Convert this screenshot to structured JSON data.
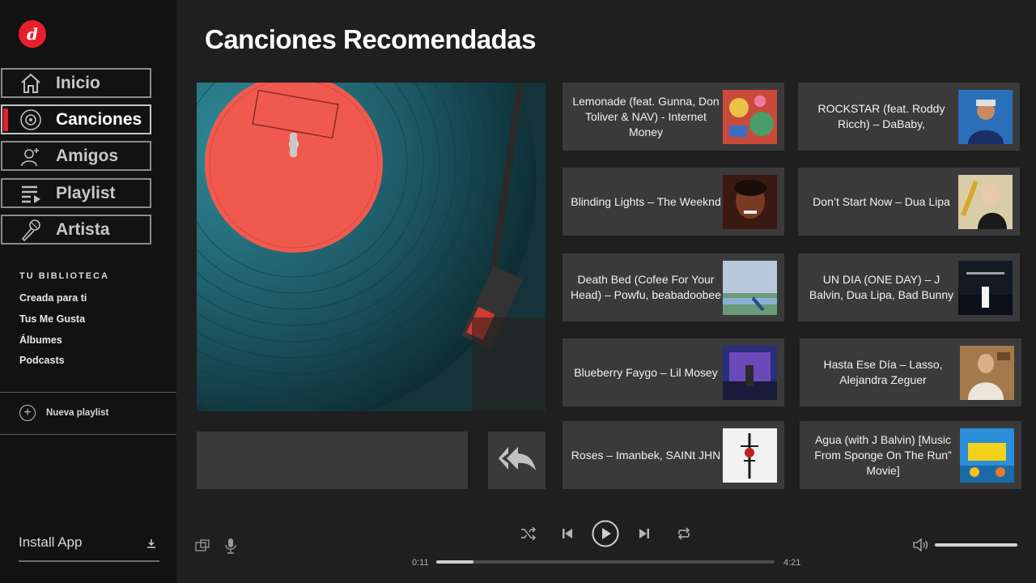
{
  "brand": {
    "logo_letter": "d"
  },
  "nav": [
    {
      "id": "inicio",
      "label": "Inicio",
      "icon": "home-icon",
      "active": false
    },
    {
      "id": "canciones",
      "label": "Canciones",
      "icon": "disc-icon",
      "active": true
    },
    {
      "id": "amigos",
      "label": "Amigos",
      "icon": "add-friend-icon",
      "active": false
    },
    {
      "id": "playlist",
      "label": "Playlist",
      "icon": "playlist-icon",
      "active": false
    },
    {
      "id": "artista",
      "label": "Artista",
      "icon": "microphone-icon",
      "active": false
    }
  ],
  "library": {
    "title": "TU BIBLIOTECA",
    "items": [
      "Creada para ti",
      "Tus Me Gusta",
      "Álbumes",
      "Podcasts"
    ]
  },
  "new_playlist": {
    "label": "Nueva playlist"
  },
  "install": {
    "label": "Install App"
  },
  "page": {
    "title": "Canciones Recomendadas"
  },
  "songs": [
    {
      "title": "Lemonade (feat. Gunna, Don Toliver & NAV) - Internet Money",
      "cover_color": "#c94a3a"
    },
    {
      "title": "ROCKSTAR (feat. Roddy Ricch) – DaBaby,",
      "cover_color": "#2a6fb8"
    },
    {
      "title": "Blinding Lights – The Weeknd",
      "cover_color": "#6b2a1a"
    },
    {
      "title": "Don’t Start Now – Dua Lipa",
      "cover_color": "#c9b68a"
    },
    {
      "title": "Death Bed (Cofee For Your Head) – Powfu, beabadoobee",
      "cover_color": "#8fa4c4"
    },
    {
      "title": "UN DIA (ONE DAY) – J Balvin, Dua Lipa, Bad Bunny",
      "cover_color": "#1a2330"
    },
    {
      "title": "Blueberry Faygo – Lil Mosey",
      "cover_color": "#3a3f8a"
    },
    {
      "title": "Hasta Ese Día – Lasso, Alejandra Zeguer",
      "cover_color": "#a47a4c"
    },
    {
      "title": "Roses – Imanbek, SAINt JHN",
      "cover_color": "#f0f0f0"
    },
    {
      "title": "Agua (with J Balvin) [Music From Sponge On The Run” Movie]",
      "cover_color": "#2a8fd8"
    }
  ],
  "player": {
    "elapsed": "0:11",
    "duration": "4:21",
    "progress_fraction": 0.11,
    "volume_fraction": 1.0
  },
  "colors": {
    "accent": "#e8202a",
    "card_bg": "#3a3a3a",
    "sidebar_bg": "#121212",
    "main_bg": "#1f1f1f"
  }
}
